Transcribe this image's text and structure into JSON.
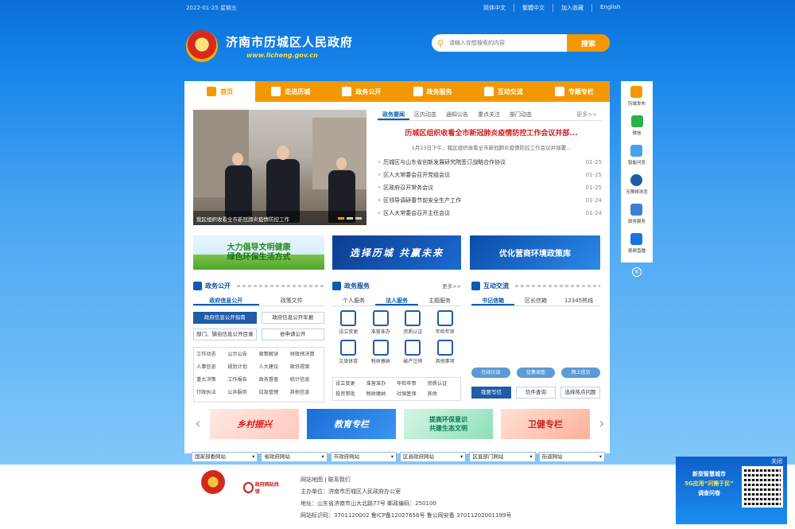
{
  "topbar": {
    "date": "2022-01-25 星期五",
    "links": [
      "简体中文",
      "繁體中文",
      "加入收藏",
      "English"
    ]
  },
  "header": {
    "title": "济南市历城区人民政府",
    "url": "www.licheng.gov.cn",
    "search_placeholder": "请输入你想搜索的内容",
    "search_button": "搜索"
  },
  "nav": [
    "首页",
    "走进历城",
    "政务公开",
    "政务服务",
    "互动交流",
    "专题专栏"
  ],
  "photo": {
    "caption": "我区组织收看全市新冠肺炎疫情防控工作"
  },
  "news": {
    "tabs": [
      "政务要闻",
      "区内动态",
      "通知公告",
      "重点关注",
      "部门动态"
    ],
    "more": "更多>>",
    "headline": "历城区组织收看全市新冠肺炎疫情防控工作会议并部...",
    "summary": "1月23日下午，我区组织收看全市新冠肺炎疫情防控工作会议并部署...",
    "items": [
      {
        "title": "历城区与山东省创新发展研究院签订战略合作协议",
        "date": "01-25"
      },
      {
        "title": "区人大常委会召开党组会议",
        "date": "01-25"
      },
      {
        "title": "区政府召开常务会议",
        "date": "01-25"
      },
      {
        "title": "区领导调研春节前安全生产工作",
        "date": "01-24"
      },
      {
        "title": "区人大常委会召开主任会议",
        "date": "01-24"
      }
    ]
  },
  "banners": {
    "b1_line1": "大力倡导文明健康",
    "b1_line2": "绿色环保生活方式",
    "b2": "选择历城 共赢未来",
    "b3": "优化营商环境政策库"
  },
  "gk": {
    "title": "政务公开",
    "tabs": [
      "政府信息公开",
      "政策文件"
    ],
    "buttons": [
      "政府信息公开指南",
      "政府信息公开年报",
      "部门、镇街信息公开目录",
      "依申请公开"
    ],
    "grid": [
      "工作动态",
      "公示公告",
      "政策解读",
      "财政预决算",
      "人事信息",
      "规划计划",
      "人大建议",
      "政协提案",
      "重大决策",
      "工作报告",
      "政务督查",
      "统计信息",
      "行政执法",
      "公共服务",
      "应急管理",
      "其他信息"
    ]
  },
  "svc": {
    "title": "政务服务",
    "more": "更多>>",
    "tabs": [
      "个人服务",
      "法人服务",
      "主题服务"
    ],
    "icons": [
      "设立变更",
      "准营准办",
      "资质认证",
      "年检年审",
      "文旅体育",
      "税收缴纳",
      "破产注销",
      "其他事项"
    ],
    "list": [
      "设立变更",
      "准营准办",
      "年检年审",
      "资质认证",
      "投资审批",
      "税收缴纳",
      "社保医保",
      "其他"
    ]
  },
  "hd": {
    "title": "互动交流",
    "tabs": [
      "书记信箱",
      "区长信箱",
      "12345热线"
    ],
    "tags": [
      "在线访谈",
      "征集调查",
      "网上信访"
    ],
    "buttons": [
      "我要写信",
      "信件查询",
      "选择热点问题"
    ]
  },
  "cards": {
    "c1": "乡村振兴",
    "c2": "教育专栏",
    "c3_line1": "提高环保意识",
    "c3_line2": "共建生态文明",
    "c4": "卫健专栏"
  },
  "selects": [
    "国家部委网站",
    "省政府网站",
    "市政府网站",
    "区县政府网站",
    "区直部门网站",
    "街道网站"
  ],
  "footer": {
    "links": "网站地图 | 联系我们",
    "sponsor": "主办单位：济南市历城区人民政府办公室",
    "address": "地址：山东省济南市山大北路77号  邮政编码：250100",
    "icp": "网站标识码：3701120002  鲁ICP备12027656号  鲁公网安备 37011202001199号",
    "logo2_text": "政府网站找错"
  },
  "rightbar": [
    "历城发布",
    "微信",
    "智能问答",
    "无障碍浏览",
    "政务服务",
    "视频直播"
  ],
  "float": {
    "close": "关闭",
    "line1": "新型智慧城市",
    "line2": "5G应用“问需于民”",
    "line3": "调查问卷"
  }
}
